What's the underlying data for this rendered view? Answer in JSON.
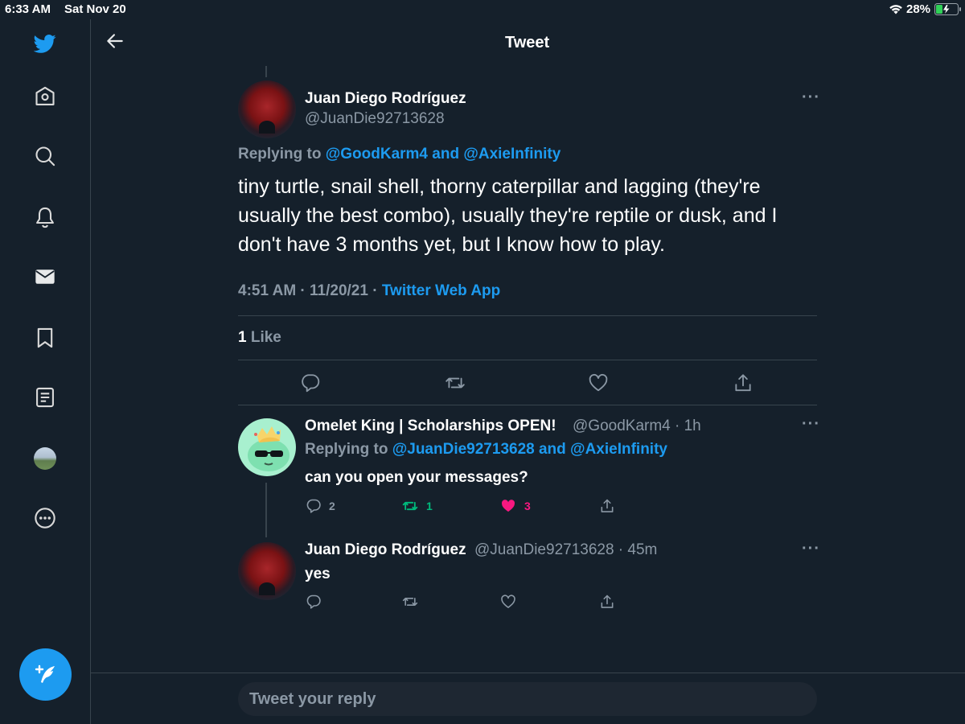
{
  "status_bar": {
    "time": "6:33 AM",
    "date": "Sat Nov 20",
    "battery_percent": "28%"
  },
  "sidebar": {
    "items": [
      {
        "icon": "twitter-logo-icon"
      },
      {
        "icon": "home-icon"
      },
      {
        "icon": "search-icon"
      },
      {
        "icon": "bell-icon"
      },
      {
        "icon": "mail-icon"
      },
      {
        "icon": "bookmark-icon"
      },
      {
        "icon": "list-icon"
      },
      {
        "icon": "profile-avatar"
      },
      {
        "icon": "more-circle-icon"
      }
    ],
    "compose_icon": "compose-feather-icon"
  },
  "header": {
    "title": "Tweet"
  },
  "main_tweet": {
    "author_name": "Juan Diego Rodríguez",
    "author_handle": "@JuanDie92713628",
    "replying_prefix": "Replying to ",
    "replying_to": "@GoodKarm4 and @AxieInfinity",
    "text": "tiny turtle, snail shell, thorny caterpillar and lagging (they're usually the best combo), usually they're reptile or dusk, and I don't have 3 months yet, but I know how to play.",
    "timestamp": "4:51 AM · 11/20/21 · ",
    "source": "Twitter Web App",
    "like_count": "1",
    "like_label": " Like",
    "more": "···"
  },
  "replies": [
    {
      "author_name": "Omelet King | Scholarships OPEN!",
      "author_handle": "@GoodKarm4 · 1h",
      "replying_prefix": "Replying to ",
      "replying_to": "@JuanDie92713628 and @AxieInfinity",
      "text": "can you open your messages?",
      "reply_count": "2",
      "retweet_count": "1",
      "like_count": "3",
      "more": "···"
    },
    {
      "author_name": "Juan Diego Rodríguez",
      "author_handle": "@JuanDie92713628 · 45m",
      "text": "yes",
      "more": "···"
    }
  ],
  "reply_bar": {
    "placeholder": "Tweet your reply"
  },
  "colors": {
    "background": "#15202b",
    "accent": "#1d9bf0",
    "retweet_green": "#00ba7c",
    "like_pink": "#f91880",
    "secondary_text": "#8b98a5"
  }
}
